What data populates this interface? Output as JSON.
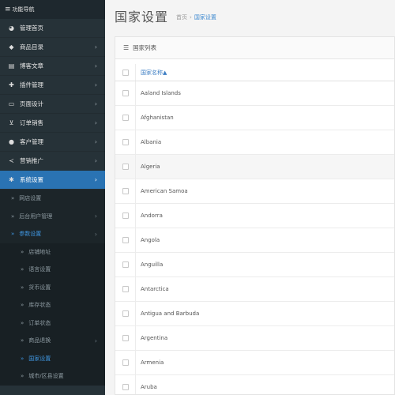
{
  "sidebar": {
    "header": "功能导航",
    "items": [
      {
        "icon": "dashboard-icon",
        "glyph": "◕",
        "label": "管理首页",
        "chevron": false
      },
      {
        "icon": "tag-icon",
        "glyph": "◆",
        "label": "商品目录",
        "chevron": true
      },
      {
        "icon": "newspaper-icon",
        "glyph": "▤",
        "label": "博客文章",
        "chevron": true
      },
      {
        "icon": "puzzle-icon",
        "glyph": "✚",
        "label": "插件管理",
        "chevron": true
      },
      {
        "icon": "monitor-icon",
        "glyph": "▭",
        "label": "页面设计",
        "chevron": true
      },
      {
        "icon": "cart-icon",
        "glyph": "⊻",
        "label": "订单销售",
        "chevron": true
      },
      {
        "icon": "user-icon",
        "glyph": "●",
        "label": "客户管理",
        "chevron": true
      },
      {
        "icon": "share-icon",
        "glyph": "≺",
        "label": "营销推广",
        "chevron": true
      },
      {
        "icon": "gear-icon",
        "glyph": "✱",
        "label": "系统设置",
        "chevron": true
      }
    ],
    "system_sub": [
      {
        "label": "网店设置",
        "chevron": false
      },
      {
        "label": "后台用户管理",
        "chevron": true
      },
      {
        "label": "参数设置",
        "chevron": true
      }
    ],
    "param_sub": [
      {
        "label": "店铺地址",
        "chevron": false
      },
      {
        "label": "语言设置",
        "chevron": false
      },
      {
        "label": "货币设置",
        "chevron": false
      },
      {
        "label": "库存状态",
        "chevron": false
      },
      {
        "label": "订单状态",
        "chevron": false
      },
      {
        "label": "商品退换",
        "chevron": true
      },
      {
        "label": "国家设置",
        "chevron": false
      },
      {
        "label": "城市/区县设置",
        "chevron": false
      }
    ]
  },
  "page": {
    "title": "国家设置",
    "breadcrumb_home": "首页",
    "breadcrumb_sep": "›",
    "breadcrumb_current": "国家设置"
  },
  "panel": {
    "title": "国家列表",
    "column_header": "国家名称",
    "sort_arrow": "▲",
    "rows": [
      "Aaland Islands",
      "Afghanistan",
      "Albania",
      "Algeria",
      "American Samoa",
      "Andorra",
      "Angola",
      "Anguilla",
      "Antarctica",
      "Antigua and Barbuda",
      "Argentina",
      "Armenia",
      "Aruba"
    ]
  },
  "colors": {
    "sidebar_bg": "#263238",
    "active_bg": "#2a73b3",
    "link_blue": "#3f8ad0"
  }
}
